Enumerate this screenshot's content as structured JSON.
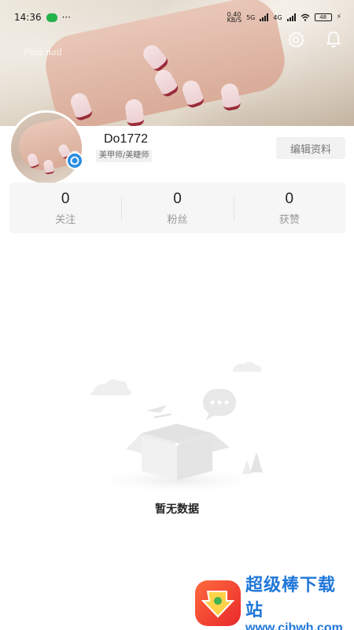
{
  "status_bar": {
    "time": "14:36",
    "dots": "···",
    "net_speed": "0.40\nKB/S",
    "sig1_label": "5G",
    "sig2_label": "4G",
    "battery": "48"
  },
  "cover": {
    "script_text": "Pina nail"
  },
  "profile": {
    "username": "Do1772",
    "role": "美甲师/美睫师",
    "edit_label": "编辑资料"
  },
  "stats": [
    {
      "value": "0",
      "label": "关注"
    },
    {
      "value": "0",
      "label": "粉丝"
    },
    {
      "value": "0",
      "label": "获赞"
    }
  ],
  "empty_state": {
    "text": "暂无数据"
  },
  "watermark": {
    "title": "超级棒下载站",
    "url": "www.cjbwh.com"
  },
  "icons": {
    "settings": "gear-icon",
    "notifications": "bell-icon",
    "avatar_badge": "verified-badge-icon"
  },
  "colors": {
    "accent_blue": "#2a8de0",
    "nail_tip": "#9b2c3a",
    "watermark_blue": "#1f77d9"
  }
}
